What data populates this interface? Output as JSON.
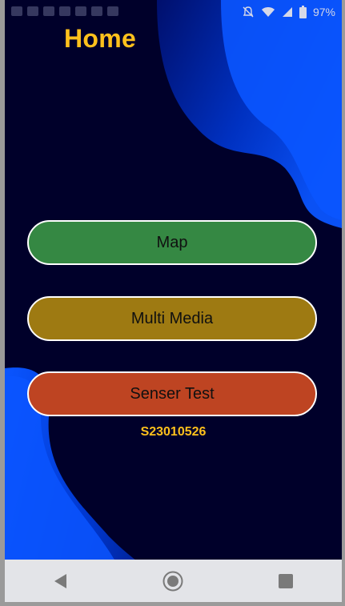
{
  "status_bar": {
    "battery_percent": "97%",
    "icons": [
      "mute-icon",
      "wifi-icon",
      "signal-icon",
      "battery-icon"
    ]
  },
  "header": {
    "title": "Home"
  },
  "menu": {
    "buttons": [
      {
        "label": "Map",
        "color": "#358843"
      },
      {
        "label": "Multi Media",
        "color": "#9e7a12"
      },
      {
        "label": "Senser Test",
        "color": "#be4422"
      }
    ]
  },
  "footer": {
    "student_id": "S23010526"
  },
  "nav_bar": {
    "icons": [
      "back-icon",
      "home-icon",
      "recents-icon"
    ]
  },
  "colors": {
    "accent": "#ffc11c",
    "background": "#00002a",
    "wave": "#0046e6"
  }
}
